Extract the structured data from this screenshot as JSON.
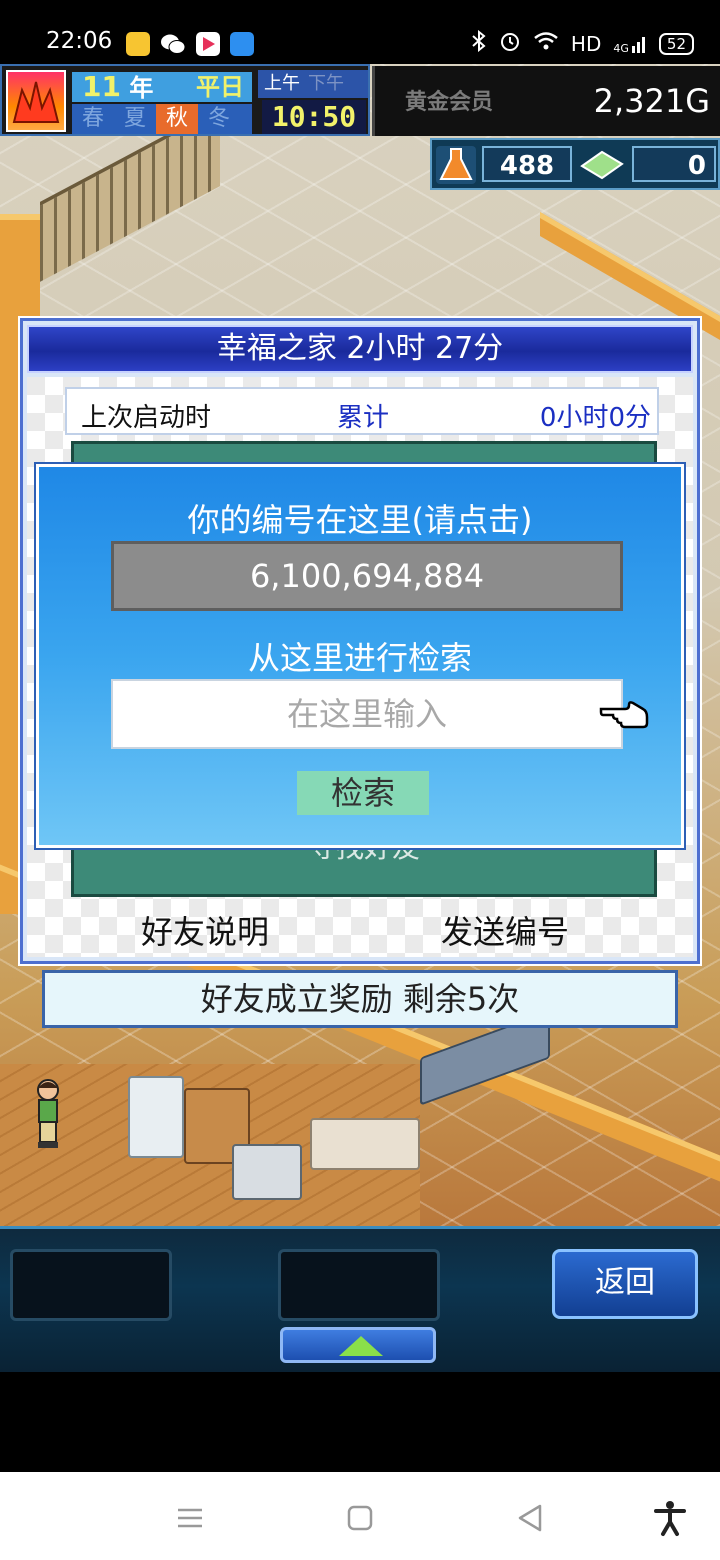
{
  "status_bar": {
    "time": "22:06",
    "network": "HD",
    "signal": "4G",
    "battery": "52",
    "colors": {
      "notes_app": "#f7c531",
      "video_app": "#e6315a",
      "cloud_app": "#2d8ff0"
    }
  },
  "hud": {
    "year_number": "11",
    "year_label": "年",
    "weekday": "平日",
    "seasons": [
      "春",
      "夏",
      "秋",
      "冬"
    ],
    "active_season": "秋",
    "am_label": "上午",
    "pm_label": "下午",
    "clock": "10:50",
    "member": "黄金会员",
    "gold": "2,321G",
    "research_points": "488",
    "tickets": "0"
  },
  "panel": {
    "title": "幸福之家  2小时 27分",
    "last_launch_label": "上次启动时",
    "cumulative_label": "累计",
    "cumulative_value": "0小时0分",
    "find_friend_label": "寻找好友",
    "friend_help_label": "好友说明",
    "send_id_label": "发送编号",
    "bonus_label": "好友成立奖励  剩余5次"
  },
  "dialog": {
    "id_heading": "你的编号在这里(请点击)",
    "player_id": "6,100,694,884",
    "search_heading": "从这里进行检索",
    "search_placeholder": "在这里输入",
    "search_value": "",
    "search_button": "检索"
  },
  "toolbar": {
    "back_label": "返回"
  }
}
